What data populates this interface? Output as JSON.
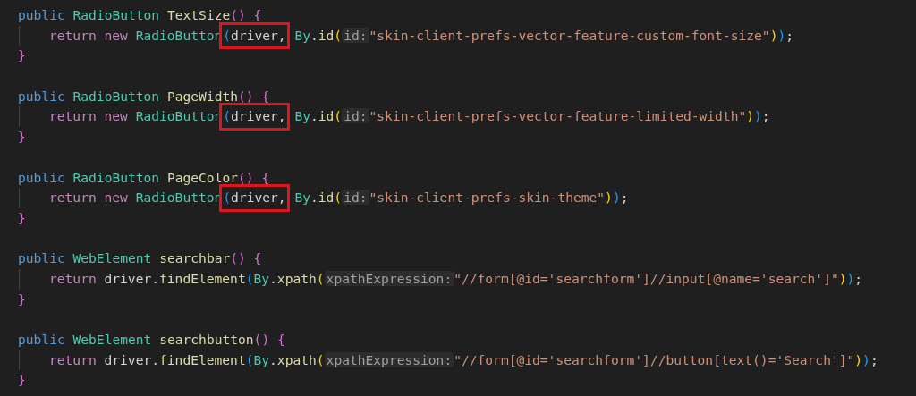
{
  "methods": [
    {
      "header": [
        {
          "text": "public",
          "kind": "keyword"
        },
        {
          "text": " RadioButton",
          "kind": "type"
        },
        {
          "text": " TextSize",
          "kind": "function"
        },
        {
          "text": "()",
          "kind": "bracket",
          "color": "#da70d6"
        },
        {
          "text": " {",
          "kind": "bracket",
          "color": "#da70d6"
        }
      ],
      "body": [
        [
          {
            "text": "return",
            "kind": "control"
          },
          {
            "text": " new",
            "kind": "control"
          },
          {
            "text": " RadioButton",
            "kind": "type"
          },
          {
            "text": "(",
            "kind": "bracket",
            "color": "#179fff",
            "boxed": true
          },
          {
            "text": "driver",
            "kind": "variable",
            "boxed": true
          },
          {
            "text": ",",
            "kind": "plain",
            "boxed": true
          },
          {
            "text": " By",
            "kind": "type"
          },
          {
            "text": ".",
            "kind": "plain"
          },
          {
            "text": "id",
            "kind": "function"
          },
          {
            "text": "(",
            "kind": "bracket",
            "color": "#ffd700"
          },
          {
            "text": "id:",
            "kind": "hint"
          },
          {
            "text": "\"skin-client-prefs-vector-feature-custom-font-size\"",
            "kind": "string"
          },
          {
            "text": ")",
            "kind": "bracket",
            "color": "#ffd700"
          },
          {
            "text": ")",
            "kind": "bracket",
            "color": "#179fff"
          },
          {
            "text": ";",
            "kind": "plain"
          }
        ]
      ],
      "close": [
        {
          "text": "}",
          "kind": "bracket",
          "color": "#da70d6"
        }
      ]
    },
    {
      "header": [
        {
          "text": "public",
          "kind": "keyword"
        },
        {
          "text": " RadioButton",
          "kind": "type"
        },
        {
          "text": " PageWidth",
          "kind": "function"
        },
        {
          "text": "()",
          "kind": "bracket",
          "color": "#da70d6"
        },
        {
          "text": " {",
          "kind": "bracket",
          "color": "#da70d6"
        }
      ],
      "body": [
        [
          {
            "text": "return",
            "kind": "control"
          },
          {
            "text": " new",
            "kind": "control"
          },
          {
            "text": " RadioButton",
            "kind": "type"
          },
          {
            "text": "(",
            "kind": "bracket",
            "color": "#179fff",
            "boxed": true
          },
          {
            "text": "driver",
            "kind": "variable",
            "boxed": true
          },
          {
            "text": ",",
            "kind": "plain",
            "boxed": true
          },
          {
            "text": " By",
            "kind": "type"
          },
          {
            "text": ".",
            "kind": "plain"
          },
          {
            "text": "id",
            "kind": "function"
          },
          {
            "text": "(",
            "kind": "bracket",
            "color": "#ffd700"
          },
          {
            "text": "id:",
            "kind": "hint"
          },
          {
            "text": "\"skin-client-prefs-vector-feature-limited-width\"",
            "kind": "string"
          },
          {
            "text": ")",
            "kind": "bracket",
            "color": "#ffd700"
          },
          {
            "text": ")",
            "kind": "bracket",
            "color": "#179fff"
          },
          {
            "text": ";",
            "kind": "plain"
          }
        ]
      ],
      "close": [
        {
          "text": "}",
          "kind": "bracket",
          "color": "#da70d6"
        }
      ]
    },
    {
      "header": [
        {
          "text": "public",
          "kind": "keyword"
        },
        {
          "text": " RadioButton",
          "kind": "type"
        },
        {
          "text": " PageColor",
          "kind": "function"
        },
        {
          "text": "()",
          "kind": "bracket",
          "color": "#da70d6"
        },
        {
          "text": " {",
          "kind": "bracket",
          "color": "#da70d6"
        }
      ],
      "body": [
        [
          {
            "text": "return",
            "kind": "control"
          },
          {
            "text": " new",
            "kind": "control"
          },
          {
            "text": " RadioButton",
            "kind": "type"
          },
          {
            "text": "(",
            "kind": "bracket",
            "color": "#179fff",
            "boxed": true
          },
          {
            "text": "driver",
            "kind": "variable",
            "boxed": true
          },
          {
            "text": ",",
            "kind": "plain",
            "boxed": true
          },
          {
            "text": " By",
            "kind": "type"
          },
          {
            "text": ".",
            "kind": "plain"
          },
          {
            "text": "id",
            "kind": "function"
          },
          {
            "text": "(",
            "kind": "bracket",
            "color": "#ffd700"
          },
          {
            "text": "id:",
            "kind": "hint"
          },
          {
            "text": "\"skin-client-prefs-skin-theme\"",
            "kind": "string"
          },
          {
            "text": ")",
            "kind": "bracket",
            "color": "#ffd700"
          },
          {
            "text": ")",
            "kind": "bracket",
            "color": "#179fff"
          },
          {
            "text": ";",
            "kind": "plain"
          }
        ]
      ],
      "close": [
        {
          "text": "}",
          "kind": "bracket",
          "color": "#da70d6"
        }
      ]
    },
    {
      "header": [
        {
          "text": "public",
          "kind": "keyword"
        },
        {
          "text": " WebElement",
          "kind": "type"
        },
        {
          "text": " searchbar",
          "kind": "function"
        },
        {
          "text": "()",
          "kind": "bracket",
          "color": "#da70d6"
        },
        {
          "text": " {",
          "kind": "bracket",
          "color": "#da70d6"
        }
      ],
      "body": [
        [
          {
            "text": "return",
            "kind": "control"
          },
          {
            "text": " driver",
            "kind": "variable"
          },
          {
            "text": ".",
            "kind": "plain"
          },
          {
            "text": "findElement",
            "kind": "function"
          },
          {
            "text": "(",
            "kind": "bracket",
            "color": "#179fff"
          },
          {
            "text": "By",
            "kind": "type"
          },
          {
            "text": ".",
            "kind": "plain"
          },
          {
            "text": "xpath",
            "kind": "function"
          },
          {
            "text": "(",
            "kind": "bracket",
            "color": "#ffd700"
          },
          {
            "text": "xpathExpression:",
            "kind": "hint"
          },
          {
            "text": "\"//form[@id='searchform']//input[@name='search']\"",
            "kind": "string"
          },
          {
            "text": ")",
            "kind": "bracket",
            "color": "#ffd700"
          },
          {
            "text": ")",
            "kind": "bracket",
            "color": "#179fff"
          },
          {
            "text": ";",
            "kind": "plain"
          }
        ]
      ],
      "close": [
        {
          "text": "}",
          "kind": "bracket",
          "color": "#da70d6"
        }
      ]
    },
    {
      "header": [
        {
          "text": "public",
          "kind": "keyword"
        },
        {
          "text": " WebElement",
          "kind": "type"
        },
        {
          "text": " searchbutton",
          "kind": "function"
        },
        {
          "text": "()",
          "kind": "bracket",
          "color": "#da70d6"
        },
        {
          "text": " {",
          "kind": "bracket",
          "color": "#da70d6"
        }
      ],
      "body": [
        [
          {
            "text": "return",
            "kind": "control"
          },
          {
            "text": " driver",
            "kind": "variable"
          },
          {
            "text": ".",
            "kind": "plain"
          },
          {
            "text": "findElement",
            "kind": "function"
          },
          {
            "text": "(",
            "kind": "bracket",
            "color": "#179fff"
          },
          {
            "text": "By",
            "kind": "type"
          },
          {
            "text": ".",
            "kind": "plain"
          },
          {
            "text": "xpath",
            "kind": "function"
          },
          {
            "text": "(",
            "kind": "bracket",
            "color": "#ffd700"
          },
          {
            "text": "xpathExpression:",
            "kind": "hint"
          },
          {
            "text": "\"//form[@id='searchform']//button[text()='Search']\"",
            "kind": "string"
          },
          {
            "text": ")",
            "kind": "bracket",
            "color": "#ffd700"
          },
          {
            "text": ")",
            "kind": "bracket",
            "color": "#179fff"
          },
          {
            "text": ";",
            "kind": "plain"
          }
        ]
      ],
      "close": [
        {
          "text": "}",
          "kind": "bracket",
          "color": "#da70d6"
        }
      ]
    }
  ]
}
